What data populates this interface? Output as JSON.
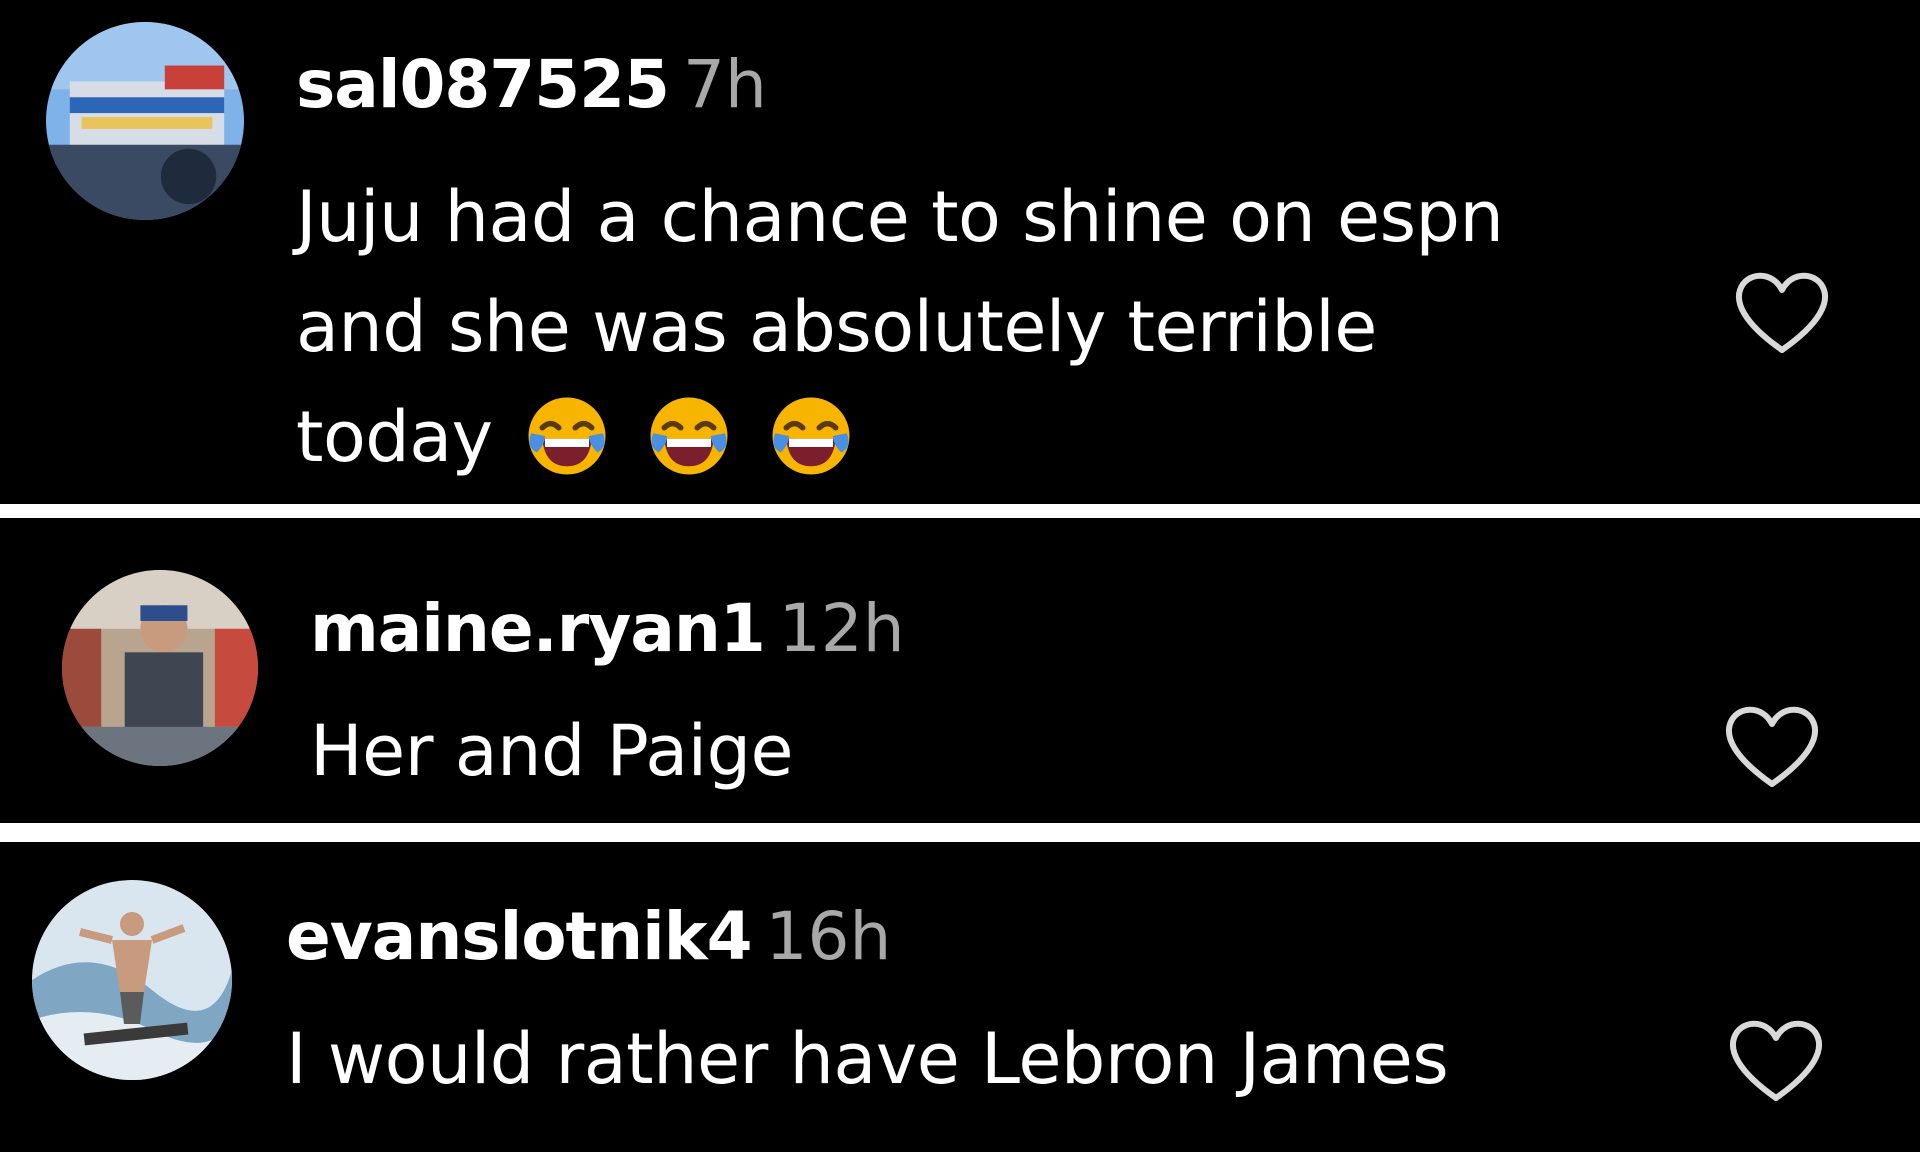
{
  "comments": [
    {
      "username": "sal087525",
      "time": "7h",
      "lines": [
        "Juju had a chance to shine on espn",
        "and she was absolutely terrible",
        "today"
      ],
      "emoji": [
        "face-with-tears-of-joy",
        "face-with-tears-of-joy",
        "face-with-tears-of-joy"
      ],
      "avatar_icon": "avatar-photo",
      "like_icon": "heart-outline-icon"
    },
    {
      "username": "maine.ryan1",
      "time": "12h",
      "lines": [
        "Her and Paige"
      ],
      "avatar_icon": "avatar-photo",
      "like_icon": "heart-outline-icon"
    },
    {
      "username": "evanslotnik4",
      "time": "16h",
      "lines": [
        "I would rather have Lebron James"
      ],
      "avatar_icon": "avatar-photo",
      "like_icon": "heart-outline-icon"
    }
  ],
  "colors": {
    "background": "#000000",
    "separator": "#ffffff",
    "username": "#ffffff",
    "timestamp": "#a8a8a8",
    "text": "#ffffff",
    "emoji_face": "#f8b500",
    "emoji_tears": "#4a90e2"
  }
}
